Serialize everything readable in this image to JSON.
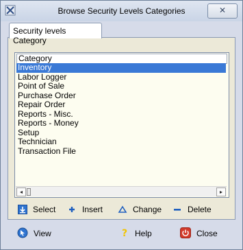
{
  "window": {
    "title": "Browse Security Levels Categories",
    "close_glyph": "✕"
  },
  "tab": {
    "label": "Security levels Category"
  },
  "list": {
    "header": "Category",
    "items": [
      "Inventory",
      "Labor Logger",
      "Point of Sale",
      "Purchase Order",
      "Repair Order",
      "Reports - Misc.",
      "Reports - Money",
      "Setup",
      "Technician",
      "Transaction File"
    ],
    "selected_index": 0
  },
  "scrollbar": {
    "left_glyph": "◂",
    "right_glyph": "▸"
  },
  "actions": {
    "select": "Select",
    "insert": "Insert",
    "change": "Change",
    "delete": "Delete"
  },
  "bottom": {
    "view": "View",
    "help": "Help",
    "close": "Close"
  },
  "colors": {
    "selection": "#3a79d6",
    "accent_blue": "#1f5fbf",
    "close_red": "#d23a2a",
    "help_yellow": "#f2c400"
  }
}
